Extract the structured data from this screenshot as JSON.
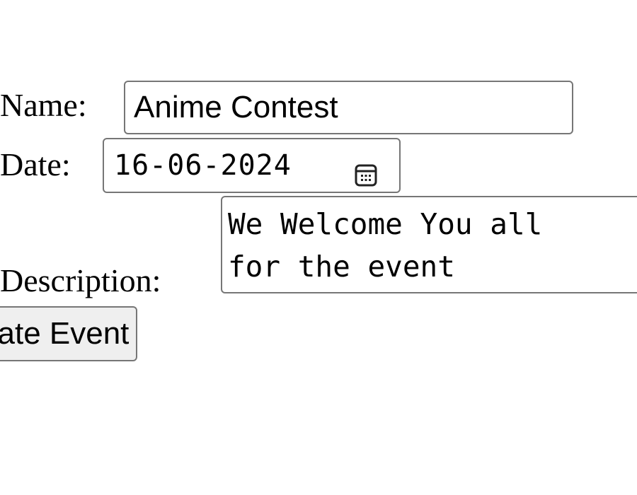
{
  "form": {
    "name_label": "Name:",
    "name_value": "Anime Contest",
    "date_label": "Date:",
    "date_value": "16-06-2024",
    "date_picker_icon": "calendar-icon",
    "description_label": "Description:",
    "description_lines": [
      "We Welcome You all",
      "for the event"
    ],
    "submit_label": "Create Event"
  },
  "colors": {
    "field_border": "#767676",
    "button_background": "#efefef",
    "text": "#000000",
    "background": "#ffffff"
  }
}
